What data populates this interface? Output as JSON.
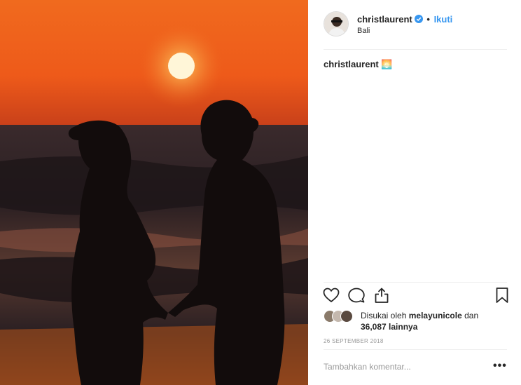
{
  "post": {
    "username": "christlaurent",
    "follow_label": "Ikuti",
    "separator": "•",
    "location": "Bali",
    "caption_username": "christlaurent",
    "caption_emoji": "🌅"
  },
  "actions": {
    "like_icon": "heart-icon",
    "comment_icon": "comment-icon",
    "share_icon": "share-icon",
    "save_icon": "bookmark-icon"
  },
  "likes": {
    "prefix": "Disukai oleh",
    "user": "melayunicole",
    "middle": "dan",
    "count": "36,087",
    "suffix": "lainnya"
  },
  "date": "26 SEPTEMBER 2018",
  "comment_placeholder": "Tambahkan komentar...",
  "more_label": "•••",
  "colors": {
    "link_blue": "#3897f0",
    "text": "#262626",
    "muted": "#999999",
    "divider": "#efefef"
  }
}
